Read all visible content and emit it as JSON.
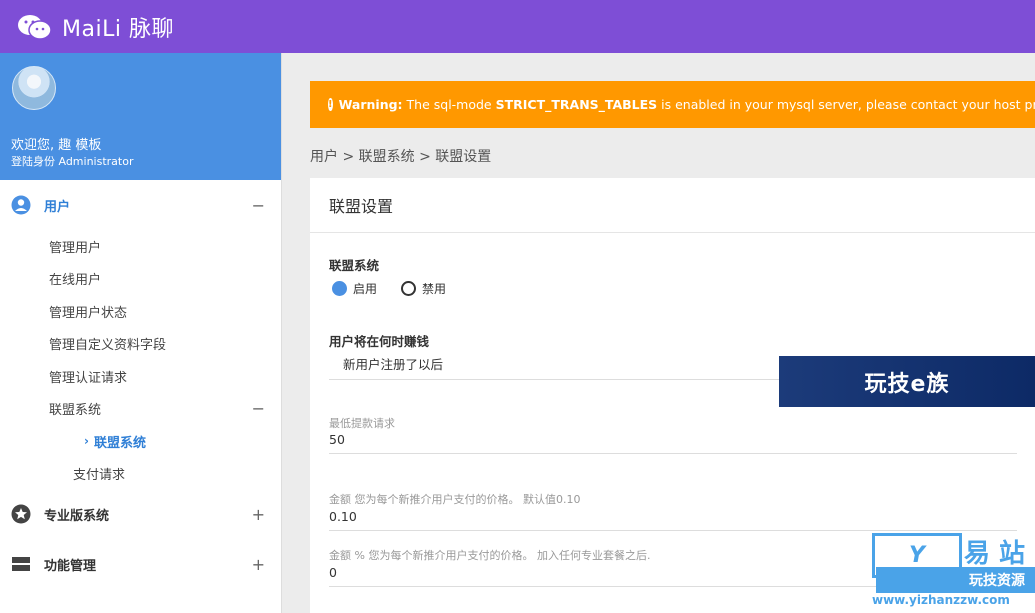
{
  "topbar": {
    "brand": "MaiLi 脉聊",
    "logo_icon": "wechat-logo-icon",
    "color": "#7e4ed6"
  },
  "profile": {
    "welcome": "欢迎您, 趣 模板",
    "role": "登陆身份 Administrator",
    "color": "#4a90e2"
  },
  "sidebar": {
    "groups": [
      {
        "label": "用户",
        "icon": "user-circle-icon",
        "toggle": "−"
      },
      {
        "label": "专业版系统",
        "icon": "star-icon",
        "toggle": "+"
      },
      {
        "label": "功能管理",
        "icon": "server-icon",
        "toggle": "+"
      }
    ],
    "user_items": [
      "管理用户",
      "在线用户",
      "管理用户状态",
      "管理自定义资料字段",
      "管理认证请求"
    ],
    "affiliate": {
      "label": "联盟系统",
      "toggle": "−",
      "active_sub": "联盟系统",
      "sub2": "支付请求"
    }
  },
  "warning": {
    "prefix": "Warning:",
    "text1": " The sql-mode ",
    "mode": "STRICT_TRANS_TABLES",
    "text2": " is enabled in your mysql server, please contact your host provider to",
    "color": "#ff9800"
  },
  "breadcrumb": "用户 > 联盟系统 > 联盟设置",
  "card": {
    "title": "联盟设置",
    "system_label": "联盟系统",
    "radio_enable": "启用",
    "radio_disable": "禁用",
    "earn_label": "用户将在何时赚钱",
    "earn_value": "新用户注册了以后",
    "min_withdraw_label": "最低提款请求",
    "min_withdraw_value": "50",
    "amount_label": "金额 您为每个新推介用户支付的价格。 默认值0.10",
    "amount_value": "0.10",
    "percent_label": "金额 % 您为每个新推介用户支付的价格。 加入任何专业套餐之后.",
    "percent_value": "0"
  },
  "watermarks": {
    "banner": "玩技e族",
    "logo_box": "Y",
    "logo_big": "易 站",
    "logo_res": "玩技资源",
    "logo_url": "www.yizhanzzw.com"
  }
}
